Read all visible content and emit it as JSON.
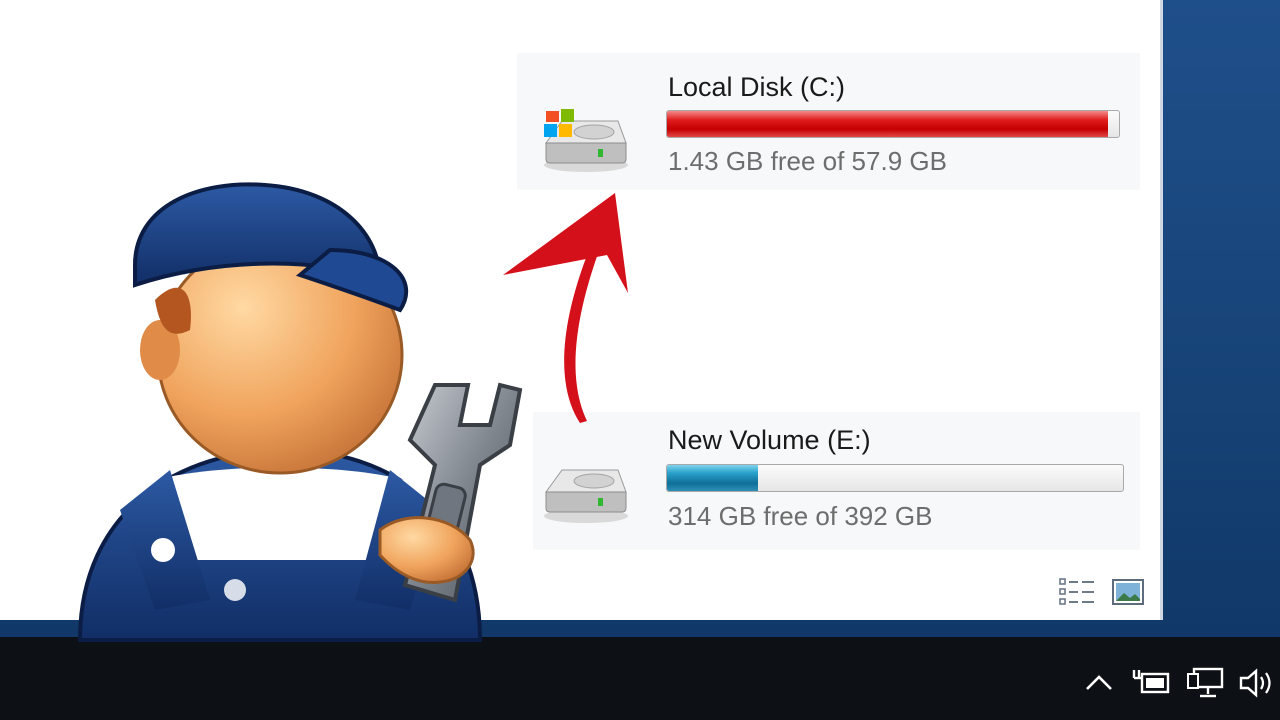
{
  "drives": [
    {
      "name": "Local Disk (C:)",
      "free_text": "1.43 GB free of 57.9 GB",
      "used_fraction": 0.975,
      "bar_color": "#d90000",
      "icon": "windows-drive-icon"
    },
    {
      "name": "New Volume (E:)",
      "free_text": "314 GB free of 392 GB",
      "used_fraction": 0.2,
      "bar_color": "#137aa6",
      "icon": "drive-icon"
    }
  ],
  "view_buttons": [
    {
      "icon": "details-view-icon"
    },
    {
      "icon": "preview-pane-icon"
    }
  ],
  "tray": [
    {
      "icon": "chevron-up-icon"
    },
    {
      "icon": "battery-plug-icon"
    },
    {
      "icon": "network-icon"
    },
    {
      "icon": "volume-icon"
    }
  ],
  "overlay": {
    "mascot_icon": "mechanic-wrench-icon",
    "arrow_icon": "red-arrow-icon",
    "arrow_color": "#d4101a"
  }
}
